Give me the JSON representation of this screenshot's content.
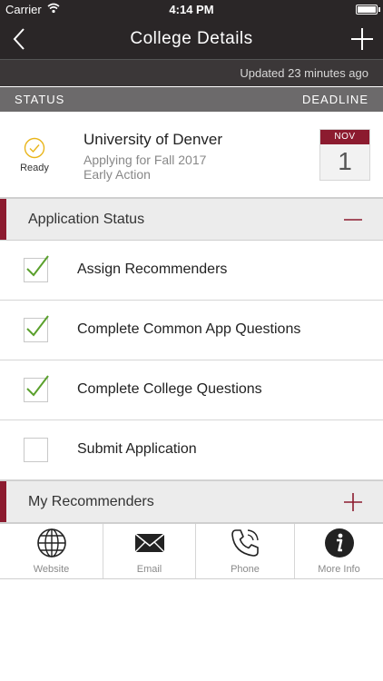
{
  "status_bar": {
    "carrier": "Carrier",
    "time": "4:14 PM"
  },
  "nav": {
    "title": "College Details",
    "back_icon": "chevron-left-icon",
    "add_icon": "plus-icon"
  },
  "updated_text": "Updated 23 minutes ago",
  "columns": {
    "status": "STATUS",
    "deadline": "DEADLINE"
  },
  "college": {
    "status_label": "Ready",
    "name": "University of Denver",
    "applying": "Applying for Fall 2017",
    "action": "Early Action",
    "deadline_month": "NOV",
    "deadline_day": "1"
  },
  "application_status": {
    "label": "Application Status",
    "expanded": true,
    "tasks": [
      {
        "label": "Assign Recommenders",
        "done": true
      },
      {
        "label": "Complete Common App Questions",
        "done": true
      },
      {
        "label": "Complete College Questions",
        "done": true
      },
      {
        "label": "Submit Application",
        "done": false
      }
    ]
  },
  "recommenders": {
    "label": "My Recommenders",
    "expanded": false
  },
  "tabs": [
    {
      "label": "Website",
      "icon": "globe-icon"
    },
    {
      "label": "Email",
      "icon": "envelope-icon"
    },
    {
      "label": "Phone",
      "icon": "phone-icon"
    },
    {
      "label": "More Info",
      "icon": "info-icon"
    }
  ],
  "colors": {
    "accent": "#8c1b2f",
    "nav_bg": "#2a2627",
    "check": "#5aa02c",
    "ready": "#e9b51a"
  }
}
